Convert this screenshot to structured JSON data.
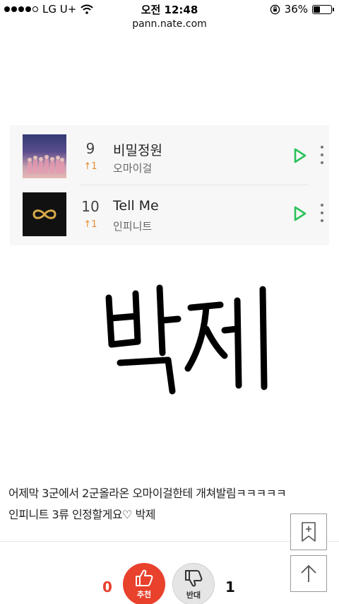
{
  "status_bar": {
    "carrier": "LG U+",
    "time": "오전 12:48",
    "battery_percent": "36%",
    "battery_level": 0.36
  },
  "url_bar": {
    "url": "pann.nate.com"
  },
  "chart_image": {
    "rows": [
      {
        "rank": "9",
        "change": "↑1",
        "title": "비밀정원",
        "artist": "오마이걸",
        "play_icon": "play-icon",
        "more_icon": "more-vertical-icon"
      },
      {
        "rank": "10",
        "change": "↑1",
        "title": "Tell Me",
        "artist": "인피니트",
        "play_icon": "play-icon",
        "more_icon": "more-vertical-icon"
      }
    ]
  },
  "handwriting_image": {
    "text": "박제"
  },
  "post": {
    "caption_line1": "어제막 3군에서 2군올라온 오마이걸한테 개쳐발림ㅋㅋㅋㅋㅋ",
    "caption_line2": "인피니트 3류 인정할게요♡ 박제"
  },
  "votes": {
    "recommend_count": "0",
    "recommend_label": "추천",
    "oppose_label": "반대",
    "oppose_count": "1"
  },
  "colors": {
    "accent_red": "#e8412c",
    "play_green": "#2bc25a",
    "rank_up_orange": "#e68a2e"
  }
}
